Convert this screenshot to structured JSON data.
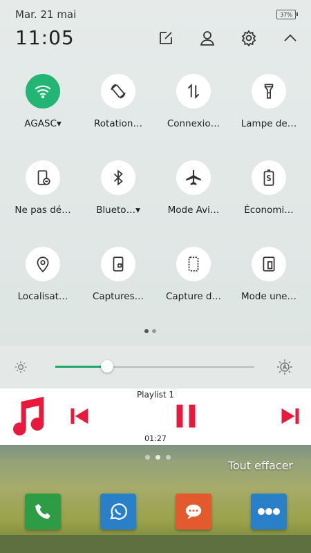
{
  "status": {
    "date": "Mar. 21 mai",
    "battery": "37%",
    "time": "11:05"
  },
  "quick_settings": [
    {
      "label": "AGASC▾",
      "icon": "wifi-icon",
      "active": true
    },
    {
      "label": "Rotation…",
      "icon": "rotation-icon",
      "active": false
    },
    {
      "label": "Connexio…",
      "icon": "data-transfer-icon",
      "active": false
    },
    {
      "label": "Lampe de…",
      "icon": "flashlight-icon",
      "active": false
    },
    {
      "label": "Ne pas dé…",
      "icon": "do-not-disturb-icon",
      "active": false
    },
    {
      "label": "Blueto…▾",
      "icon": "bluetooth-icon",
      "active": false
    },
    {
      "label": "Mode Avi…",
      "icon": "airplane-icon",
      "active": false
    },
    {
      "label": "Économi…",
      "icon": "battery-saver-icon",
      "active": false
    },
    {
      "label": "Localisat…",
      "icon": "location-icon",
      "active": false
    },
    {
      "label": "Captures…",
      "icon": "screenshot-icon",
      "active": false
    },
    {
      "label": "Capture d…",
      "icon": "screen-record-icon",
      "active": false
    },
    {
      "label": "Mode une…",
      "icon": "one-hand-mode-icon",
      "active": false
    }
  ],
  "brightness": {
    "level": 0.26
  },
  "player": {
    "playlist": "Playlist 1",
    "elapsed": "01:27",
    "accent": "#e8193c"
  },
  "wallpaper": {
    "clear_all": "Tout effacer"
  },
  "colors": {
    "active_toggle": "#22b573",
    "slider_fill": "#1aa86a"
  }
}
